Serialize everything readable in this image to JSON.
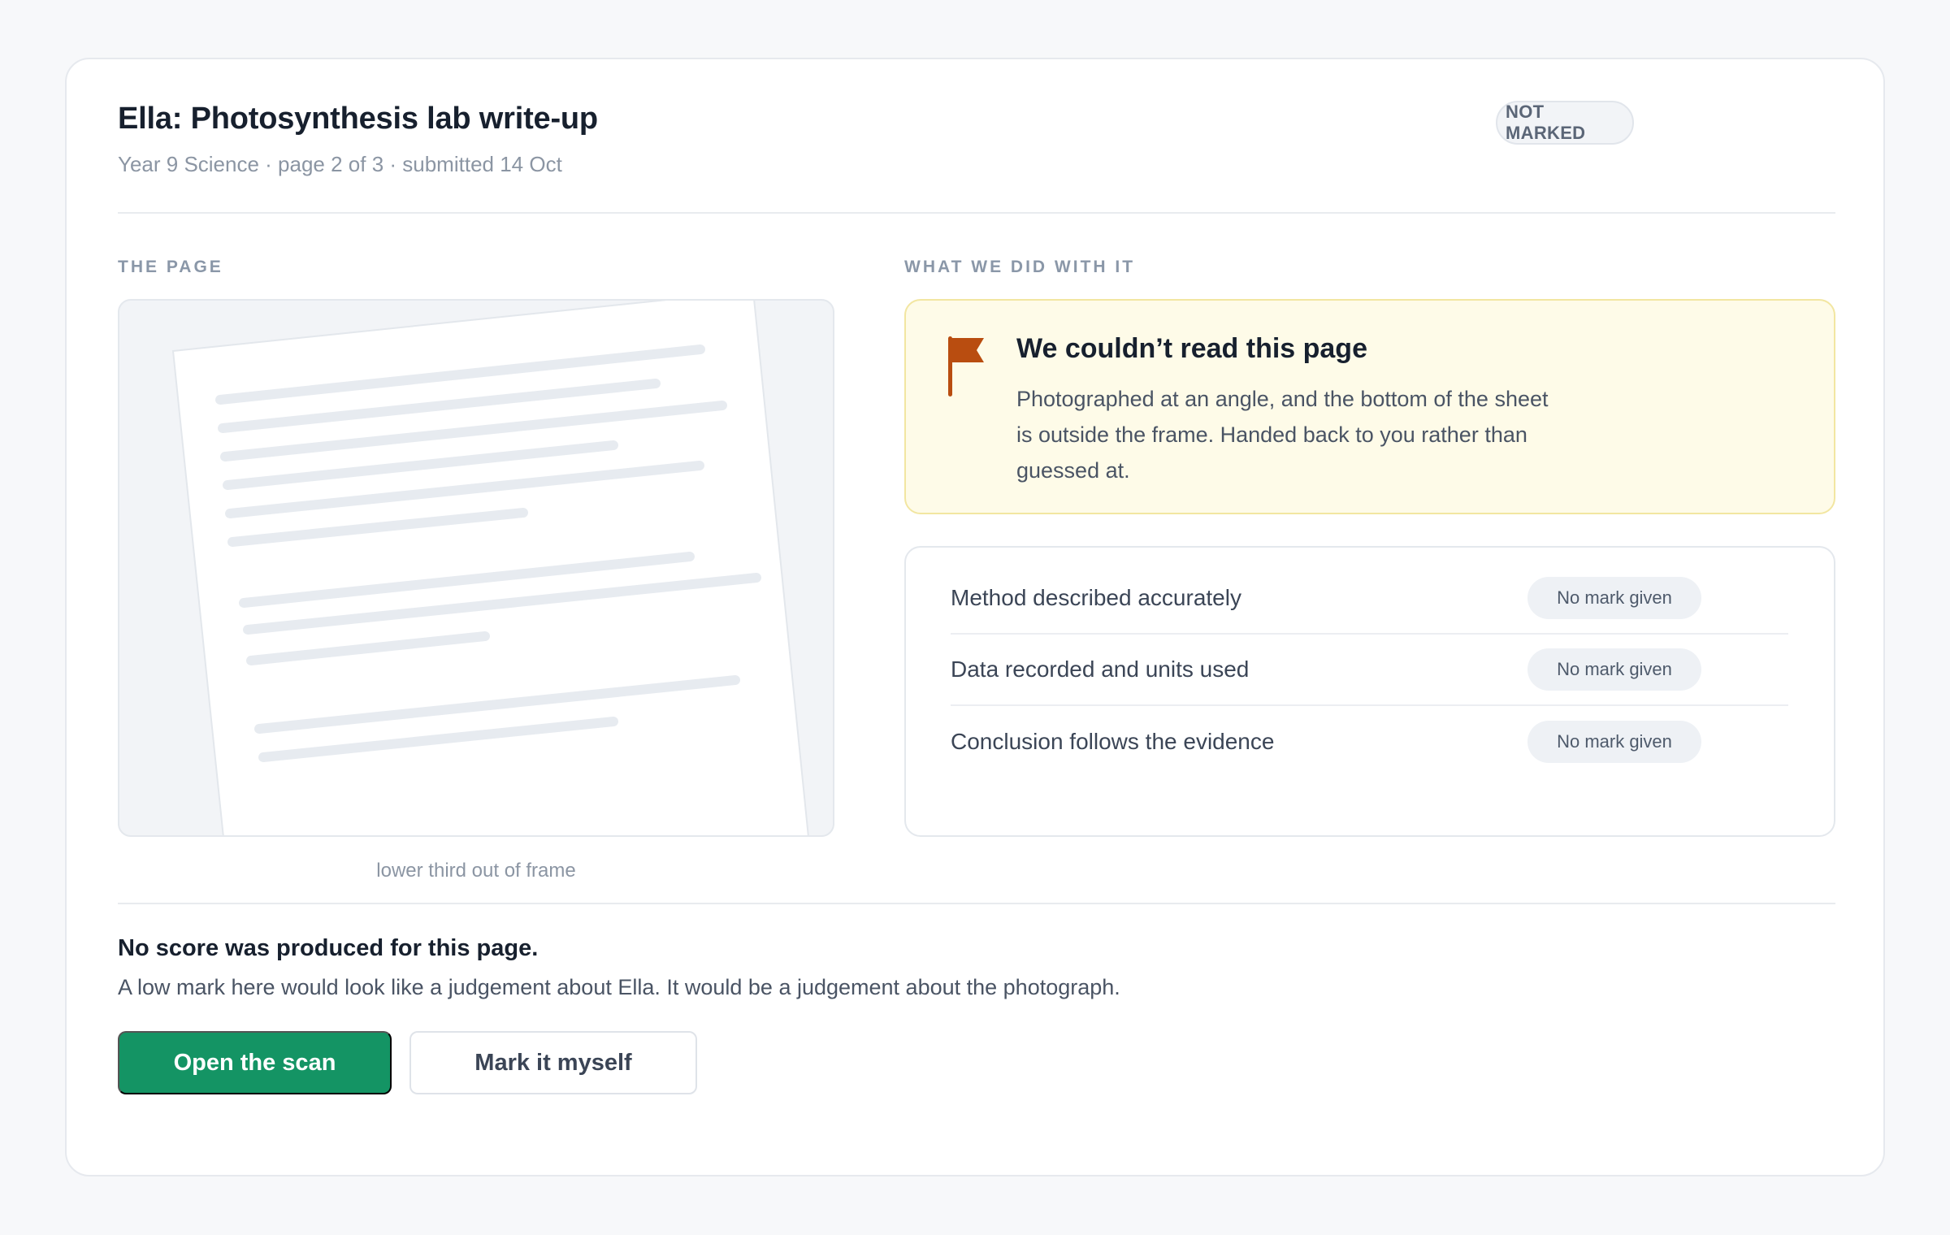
{
  "header": {
    "title": "Ella: Photosynthesis lab write-up",
    "subtitle": "Year 9 Science · page 2 of 3 · submitted 14 Oct",
    "status_badge": "NOT MARKED"
  },
  "page_section": {
    "label": "THE PAGE",
    "caption": "lower third out of frame"
  },
  "result_section": {
    "label": "WHAT WE DID WITH IT",
    "notice": {
      "icon": "flag-icon",
      "title": "We couldn’t read this page",
      "body": "Photographed at an angle, and the bottom of the sheet is outside the frame. Handed back to you rather than guessed at."
    },
    "criteria": [
      {
        "label": "Method described accurately",
        "mark": "No mark given"
      },
      {
        "label": "Data recorded and units used",
        "mark": "No mark given"
      },
      {
        "label": "Conclusion follows the evidence",
        "mark": "No mark given"
      }
    ]
  },
  "footer": {
    "score_title": "No score was produced for this page.",
    "score_body": "A low mark here would look like a judgement about Ella. It would be a judgement about the photograph.",
    "primary_button": "Open the scan",
    "secondary_button": "Mark it myself"
  },
  "colors": {
    "accent": "#149464",
    "notice_bg": "#fefbe8",
    "flag": "#b94d10"
  }
}
